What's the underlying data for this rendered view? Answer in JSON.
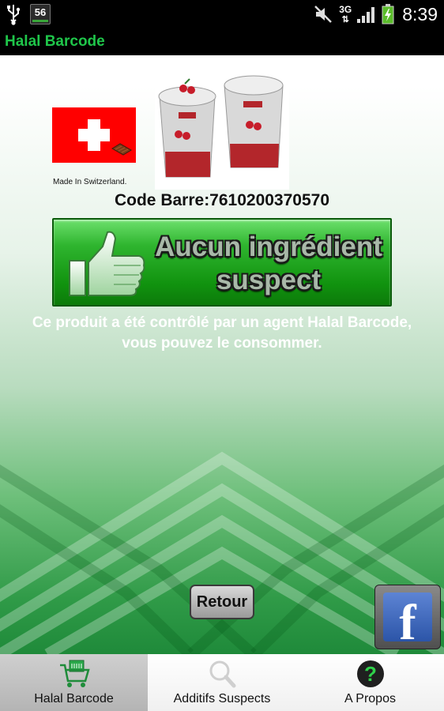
{
  "status_bar": {
    "notification_count": "56",
    "network": "3G",
    "time": "8:39",
    "icons": [
      "usb-icon",
      "mute-icon",
      "signal-icon",
      "battery-charging-icon"
    ]
  },
  "app": {
    "title": "Halal Barcode"
  },
  "product": {
    "origin_label": "Made In Switzerland.",
    "barcode_text": "Code Barre:7610200370570",
    "image": "yogurt-cups-image",
    "flag": "swiss-flag-icon"
  },
  "verdict": {
    "line1": "Aucun ingrédient",
    "line2": "suspect",
    "icon": "thumbs-up-icon"
  },
  "info": {
    "line1": "Ce produit a été contrôlé par un agent Halal Barcode,",
    "line2": "vous pouvez le consommer."
  },
  "actions": {
    "back_label": "Retour",
    "facebook_icon": "facebook-icon"
  },
  "tabs": [
    {
      "label": "Halal Barcode",
      "icon": "cart-icon",
      "active": true
    },
    {
      "label": "Additifs Suspects",
      "icon": "magnifier-icon",
      "active": false
    },
    {
      "label": "A Propos",
      "icon": "help-icon",
      "active": false
    }
  ],
  "colors": {
    "accent_green": "#1fc64a",
    "verdict_green": "#11930f"
  }
}
